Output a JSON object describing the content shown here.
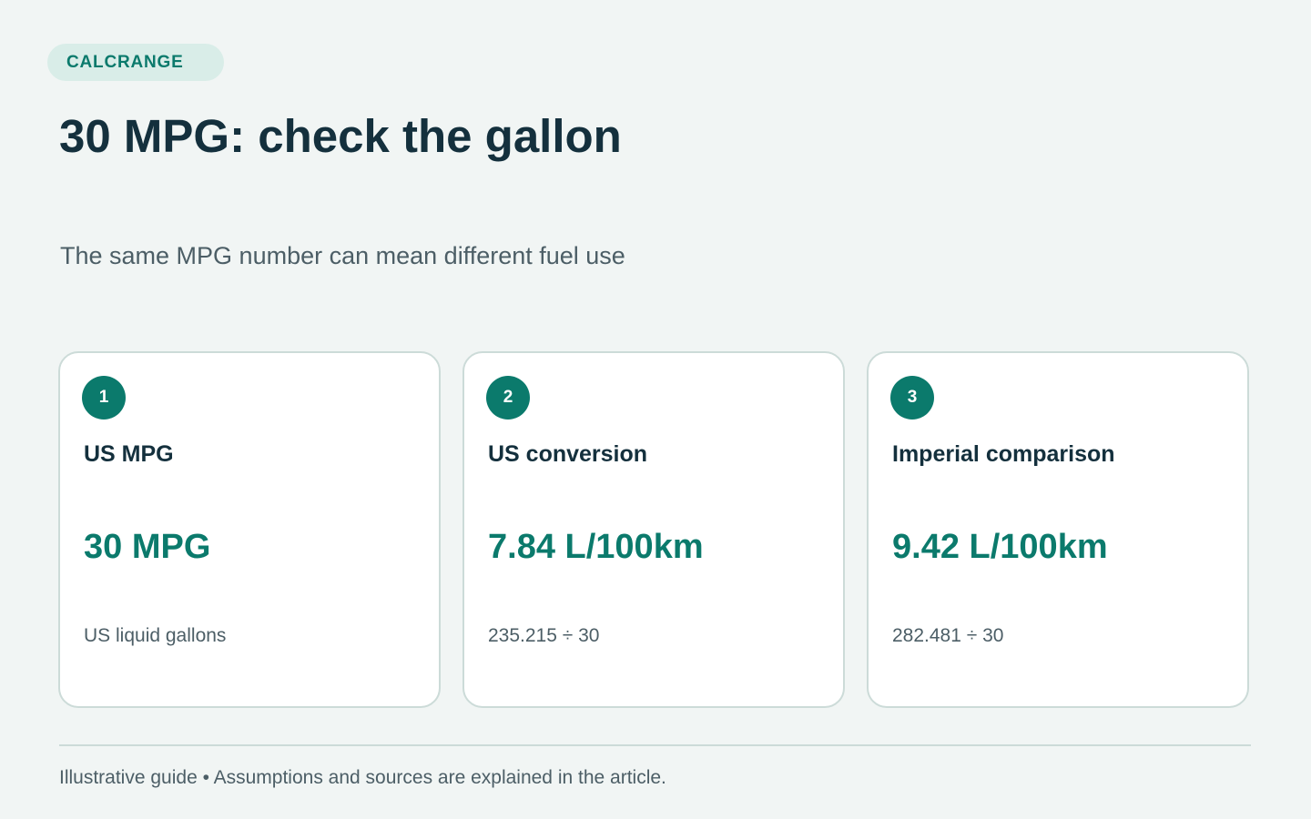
{
  "brand": {
    "label": "CALCRANGE"
  },
  "header": {
    "title": "30 MPG: check the gallon",
    "subtitle": "The same MPG number can mean different fuel use"
  },
  "cards": [
    {
      "step": "1",
      "title": "US MPG",
      "value": "30 MPG",
      "note": "US liquid gallons"
    },
    {
      "step": "2",
      "title": "US conversion",
      "value": "7.84 L/100km",
      "note": "235.215 ÷ 30"
    },
    {
      "step": "3",
      "title": "Imperial comparison",
      "value": "9.42 L/100km",
      "note": "282.481 ÷ 30"
    }
  ],
  "footer": {
    "note": "Illustrative guide • Assumptions and sources are explained in the article."
  },
  "colors": {
    "background": "#f1f5f4",
    "accent": "#0b7a6c",
    "pill": "#d9ede8",
    "heading": "#14303d",
    "muted_text": "#4c5e66",
    "card_border": "#ccdbd8"
  }
}
